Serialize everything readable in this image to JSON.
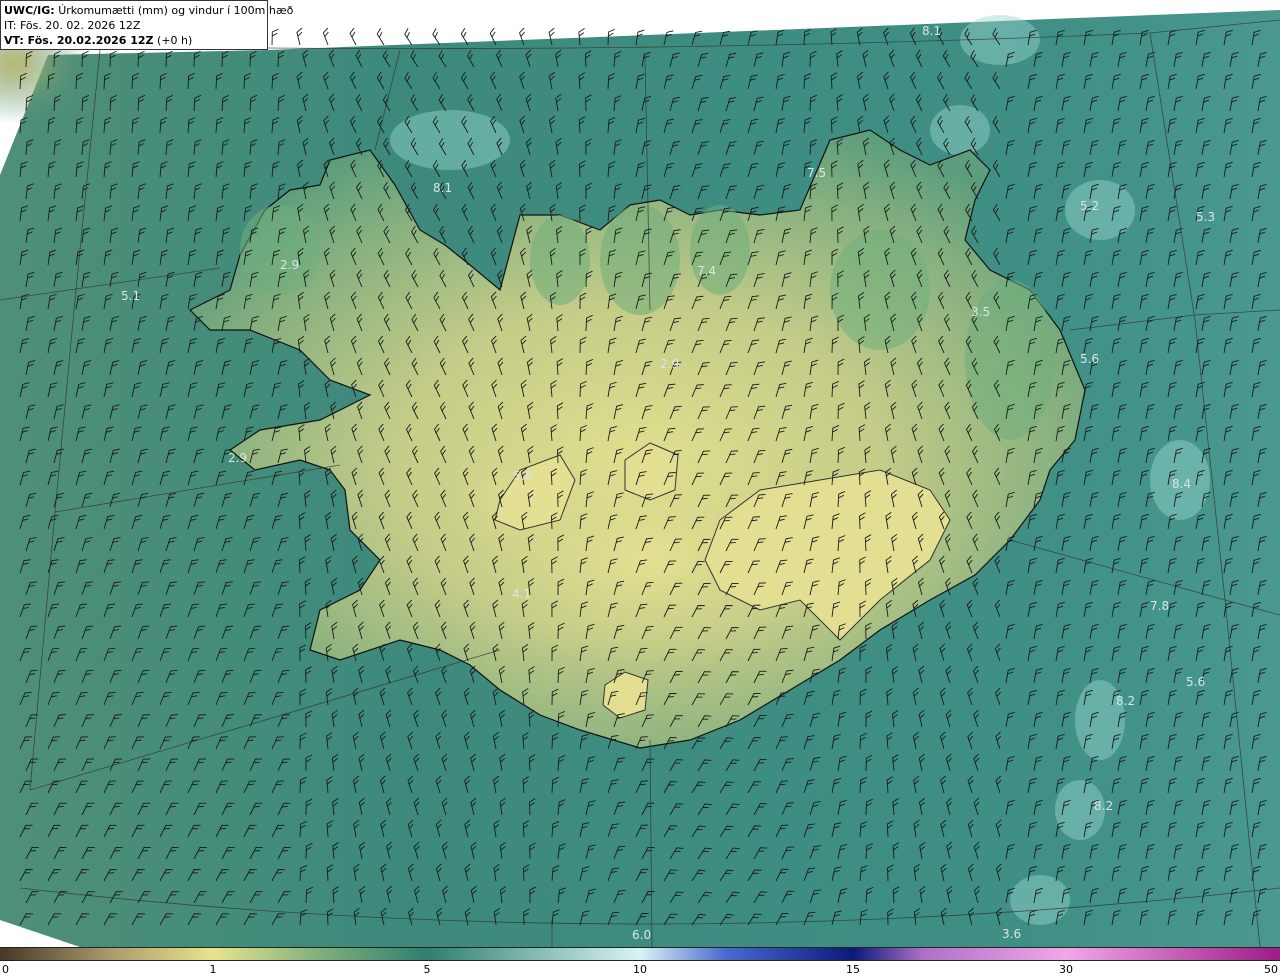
{
  "header": {
    "product": "UWC/IG:",
    "description": "Úrkomumætti (mm) og vindur í 100m hæð",
    "init_prefix": "IT:",
    "init_time": "Fös. 20. 02. 2026 12Z",
    "valid_prefix": "VT: Fös. 20.02.2026 12Z",
    "valid_offset": "(+0 h)"
  },
  "colors": {
    "sea_base": "#3f8a7a",
    "land_low": "#b8c888",
    "land_high": "#dde08f",
    "highland_green": "#6aa87a",
    "coast_line": "#111111",
    "grid_line": "#333333",
    "wind_barb": "#1a1a1a"
  },
  "value_labels": [
    "8.1",
    "7.5",
    "8.1",
    "2.9",
    "5.1",
    "7.4",
    "3.5",
    "5.3",
    "2.9",
    "5.6",
    "2.9",
    "5.8",
    "4.1",
    "8.4",
    "7.8",
    "5.6",
    "8.2",
    "8.2",
    "6.0",
    "5.2",
    "3.6"
  ],
  "colorbar": {
    "ticks": [
      "0",
      "1",
      "5",
      "10",
      "15",
      "30",
      "50"
    ],
    "tick_values": [
      0,
      1,
      5,
      10,
      15,
      30,
      50
    ],
    "stops": [
      {
        "value": 0,
        "color": "#4a3a2a"
      },
      {
        "value": 0.5,
        "color": "#a89a6a"
      },
      {
        "value": 1,
        "color": "#e8e48c"
      },
      {
        "value": 3,
        "color": "#7fb07d"
      },
      {
        "value": 5,
        "color": "#2f7f6e"
      },
      {
        "value": 10,
        "color": "#d8f4f4"
      },
      {
        "value": 12,
        "color": "#4a6ad0"
      },
      {
        "value": 15,
        "color": "#0a1a7a"
      },
      {
        "value": 20,
        "color": "#b070c8"
      },
      {
        "value": 30,
        "color": "#f0a8e8"
      },
      {
        "value": 50,
        "color": "#a0208a"
      }
    ]
  }
}
